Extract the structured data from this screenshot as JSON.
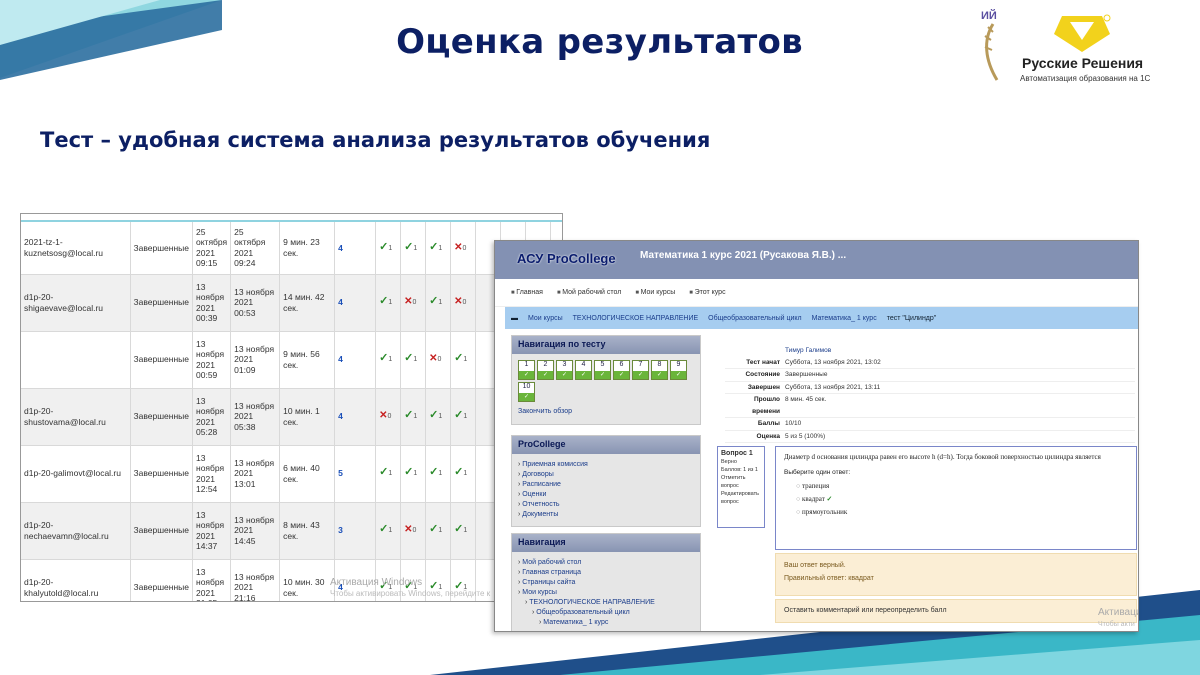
{
  "slide": {
    "title": "Оценка результатов",
    "subtitle": "Тест –  удобная система анализа результатов обучения",
    "logo_left_fragment": "ИЙ",
    "logo_brand": "Русские Решения",
    "logo_tagline": "Автоматизация образования на 1С"
  },
  "results_table": {
    "rows": [
      {
        "email": "2021-tz-1-kuznetsosg@local.ru",
        "state": "Завершенные",
        "started": "25 октября 2021 09:15",
        "finished": "25 октября 2021 09:24",
        "time": "9 мин. 23 сек.",
        "score": "4",
        "marks": [
          "ok",
          "ok",
          "ok",
          "bad"
        ]
      },
      {
        "email": "d1p-20-shigaevave@local.ru",
        "state": "Завершенные",
        "started": "13 ноября 2021 00:39",
        "finished": "13 ноября 2021 00:53",
        "time": "14 мин. 42 сек.",
        "score": "4",
        "marks": [
          "ok",
          "bad",
          "ok",
          "bad"
        ]
      },
      {
        "email": "",
        "state": "Завершенные",
        "started": "13 ноября 2021 00:59",
        "finished": "13 ноября 2021 01:09",
        "time": "9 мин. 56 сек.",
        "score": "4",
        "marks": [
          "ok",
          "ok",
          "bad",
          "ok"
        ]
      },
      {
        "email": "d1p-20-shustovama@local.ru",
        "state": "Завершенные",
        "started": "13 ноября 2021 05:28",
        "finished": "13 ноября 2021 05:38",
        "time": "10 мин. 1 сек.",
        "score": "4",
        "marks": [
          "bad",
          "ok",
          "ok",
          "ok"
        ]
      },
      {
        "email": "d1p-20-galimovt@local.ru",
        "state": "Завершенные",
        "started": "13 ноября 2021 12:54",
        "finished": "13 ноября 2021 13:01",
        "time": "6 мин. 40 сек.",
        "score": "5",
        "marks": [
          "ok",
          "ok",
          "ok",
          "ok"
        ]
      },
      {
        "email": "d1p-20-nechaevamn@local.ru",
        "state": "Завершенные",
        "started": "13 ноября 2021 14:37",
        "finished": "13 ноября 2021 14:45",
        "time": "8 мин. 43 сек.",
        "score": "3",
        "marks": [
          "ok",
          "bad",
          "ok",
          "ok"
        ]
      },
      {
        "email": "d1p-20-khalyutold@local.ru",
        "state": "Завершенные",
        "started": "13 ноября 2021 21:05",
        "finished": "13 ноября 2021 21:16",
        "time": "10 мин. 30 сек.",
        "score": "4",
        "marks": [
          "ok",
          "ok",
          "ok",
          "ok"
        ]
      }
    ],
    "watermark_title": "Активация Windows",
    "watermark_text": "Чтобы активировать Windows, перейдите к"
  },
  "moodle": {
    "logo": "АСУ ProCollege",
    "course_title": "Математика 1 курс 2021 (Русакова Я.В.) ...",
    "menu": [
      "Главная",
      "Мой рабочий стол",
      "Мои курсы",
      "Этот курс"
    ],
    "breadcrumb": [
      "Мои курсы",
      "ТЕХНОЛОГИЧЕСКОЕ НАПРАВЛЕНИЕ",
      "Общеобразовательный цикл",
      "Математика_ 1 курс",
      "тест \"Цилиндр\""
    ],
    "quiz_nav": {
      "title": "Навигация по тесту",
      "cells": [
        "1",
        "2",
        "3",
        "4",
        "5",
        "6",
        "7",
        "8",
        "9",
        "10"
      ],
      "finish_link": "Закончить обзор"
    },
    "procollege": {
      "title": "ProCollege",
      "items": [
        "Приемная комиссия",
        "Договоры",
        "Расписание",
        "Оценки",
        "Отчетность",
        "Документы"
      ]
    },
    "navigation": {
      "title": "Навигация",
      "items": [
        "Мой рабочий стол",
        "Главная страница",
        "Страницы сайта",
        "Мои курсы",
        "ТЕХНОЛОГИЧЕСКОЕ НАПРАВЛЕНИЕ",
        "Общеобразовательный цикл",
        "Математика_ 1 курс"
      ]
    },
    "summary": {
      "user": "Тимур Галимов",
      "rows": [
        {
          "k": "Тест начат",
          "v": "Суббота, 13 ноября 2021, 13:02"
        },
        {
          "k": "Состояние",
          "v": "Завершенные"
        },
        {
          "k": "Завершен",
          "v": "Суббота, 13 ноября 2021, 13:11"
        },
        {
          "k": "Прошло времени",
          "v": "8 мин. 45 сек."
        },
        {
          "k": "Баллы",
          "v": "10/10"
        },
        {
          "k": "Оценка",
          "v": "5 из 5 (100%)"
        }
      ]
    },
    "question": {
      "info_title": "Вопрос 1",
      "info_state": "Верно",
      "info_points": "Баллов: 1 из 1",
      "info_flag": "Отметить вопрос",
      "info_edit": "Редактировать вопрос",
      "text": "Диаметр d основания цилиндра равен его высоте h (d=h). Тогда боковой поверхностью цилиндра является",
      "prompt": "Выберите один ответ:",
      "options": [
        "трапеция",
        "квадрат",
        "прямоугольник"
      ]
    },
    "feedback": {
      "line1": "Ваш ответ верный.",
      "line2": "Правильный ответ: квадрат"
    },
    "comment": "Оставить комментарий или переопределить балл",
    "watermark_title": "Активаци",
    "watermark_text": "Чтобы акти"
  }
}
